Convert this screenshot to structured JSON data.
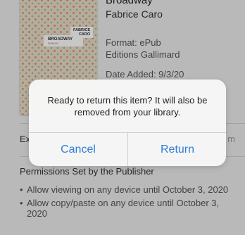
{
  "book": {
    "title": "Broadway",
    "author": "Fabrice Caro",
    "format": "Format: ePub",
    "publisher": "Editions Gallimard",
    "date_added": "Date Added: 9/3/20",
    "cover": {
      "title": "BROADWAY",
      "subtitle": "ROMAN",
      "author": "FABRICE\nCARO"
    }
  },
  "details": {
    "row_label": "Ex",
    "row_tail": "m"
  },
  "permissions": {
    "heading": "Permissions Set by the Publisher",
    "items": [
      "Allow viewing on any device until October 3, 2020",
      "Allow copy/paste on any device until October 3, 2020"
    ],
    "bullet": "•"
  },
  "alert": {
    "message": "Ready to return this item? It will also be removed from your library.",
    "cancel_label": "Cancel",
    "return_label": "Return",
    "accent_color": "#2f7fd6"
  }
}
